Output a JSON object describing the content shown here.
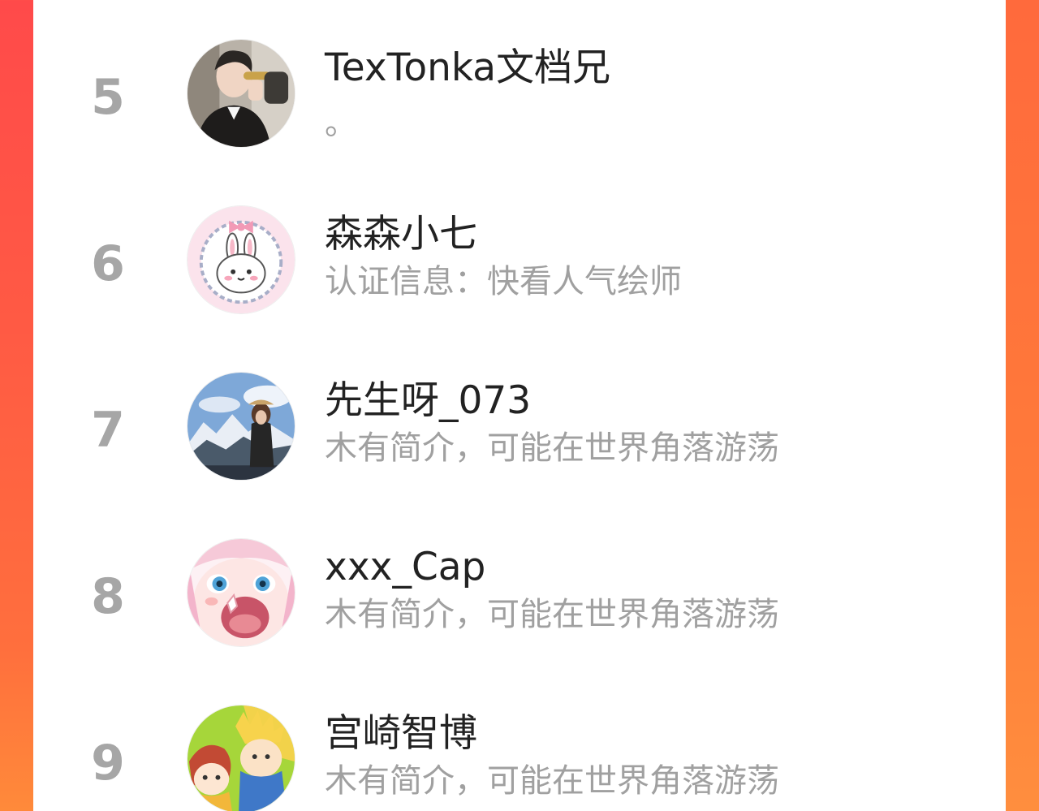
{
  "users": [
    {
      "rank": "5",
      "name": "TexTonka文档兄",
      "desc": "。",
      "avatar": "avatar-photo-man-trophy"
    },
    {
      "rank": "6",
      "name": "森森小七",
      "desc": "认证信息：快看人气绘师",
      "avatar": "avatar-bunny-illustration"
    },
    {
      "rank": "7",
      "name": "先生呀_073",
      "desc": "木有简介，可能在世界角落游荡",
      "avatar": "avatar-photo-mountains"
    },
    {
      "rank": "8",
      "name": "xxx_Cap",
      "desc": "木有简介，可能在世界角落游荡",
      "avatar": "avatar-anime-girl"
    },
    {
      "rank": "9",
      "name": "宫崎智博",
      "desc": "木有简介，可能在世界角落游荡",
      "avatar": "avatar-anime-boys"
    }
  ],
  "colors": {
    "background_left": "#ff4a4a",
    "background_right": "#ff7a3a",
    "rank_text": "#a6a6a6",
    "name_text": "#222222",
    "desc_text": "#a0a0a0"
  }
}
